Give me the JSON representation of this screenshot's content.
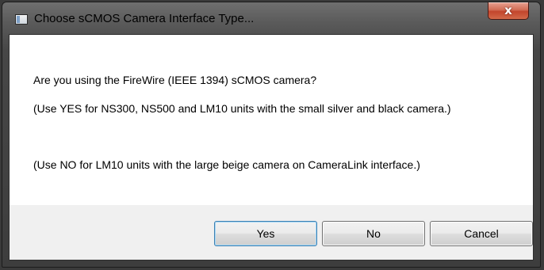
{
  "window": {
    "title": "Choose sCMOS Camera Interface Type...",
    "close_symbol": "x"
  },
  "message": {
    "question": "Are you using the FireWire (IEEE 1394) sCMOS camera?",
    "yes_hint": "(Use YES for NS300, NS500 and LM10 units with the small silver and black camera.)",
    "no_hint": "(Use NO for LM10 units with the large beige camera on CameraLink interface.)"
  },
  "buttons": {
    "yes": "Yes",
    "no": "No",
    "cancel": "Cancel"
  },
  "icons": [
    "app-window-icon",
    "close-icon"
  ],
  "colors": {
    "close_button": "#c7472e",
    "default_button_border": "#3c7fb1"
  }
}
